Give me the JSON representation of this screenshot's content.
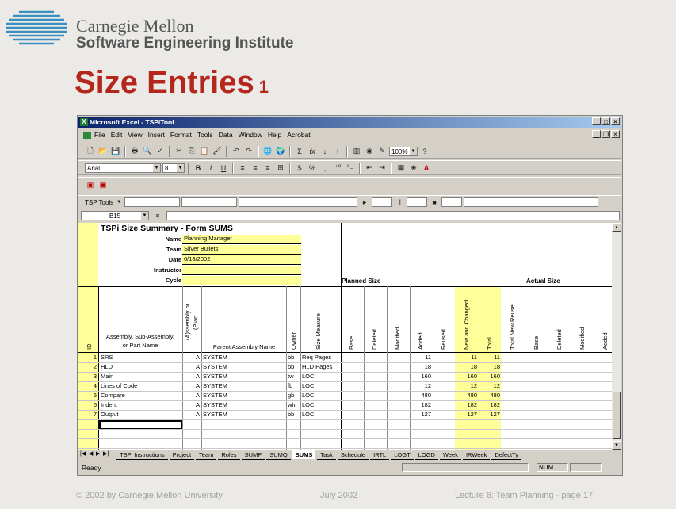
{
  "slide": {
    "org_line1": "Carnegie Mellon",
    "org_line2": "Software Engineering Institute",
    "title": "Size Entries",
    "title_num": "1",
    "footer_left": "© 2002 by Carnegie Mellon University",
    "footer_mid": "July 2002",
    "footer_right": "Lecture 6: Team Planning - page 17"
  },
  "app": {
    "title": "Microsoft Excel - TSPiTool",
    "menu": [
      "File",
      "Edit",
      "View",
      "Insert",
      "Format",
      "Tools",
      "Data",
      "Window",
      "Help",
      "Acrobat"
    ],
    "zoom": "100%",
    "font_name": "Arial",
    "font_size": "8",
    "tsp_tools": "TSP Tools",
    "name_box": "B15",
    "formula_eq": "=",
    "status": "Ready",
    "num_indicator": "NUM"
  },
  "form": {
    "title": "TSPi Size Summary - Form SUMS",
    "labels": {
      "name": "Name",
      "team": "Team",
      "date": "Date",
      "instructor": "Instructor",
      "cycle": "Cycle"
    },
    "values": {
      "name": "Planning Manager",
      "team": "Silver Bullets",
      "date": "6/18/2002",
      "instructor": "",
      "cycle": ""
    },
    "planned_size": "Planned Size",
    "actual_size": "Actual Size",
    "headers": {
      "id": "ID",
      "assembly": "Assembly, Sub-Assembly,",
      "assembly2": "or Part Name",
      "ap": "(A)ssembly or",
      "ap2": "(P)art",
      "parent": "Parent Assembly Name",
      "owner": "Owner",
      "size_measure": "Size Measure",
      "base": "Base",
      "deleted": "Deleted",
      "modified": "Modified",
      "added": "Added",
      "reused": "Reused",
      "new_changed": "New and Changed",
      "total": "Total",
      "total_new_reuse": "Total New Reuse",
      "a_base": "Base",
      "a_deleted": "Deleted",
      "a_modified": "Modified",
      "a_added": "Added"
    },
    "rows": [
      {
        "id": "1",
        "name": "SRS",
        "ap": "A",
        "parent": "SYSTEM",
        "owner": "bb",
        "measure": "Req Pages",
        "added": "11",
        "nc": "11",
        "total": "11"
      },
      {
        "id": "2",
        "name": "HLD",
        "ap": "A",
        "parent": "SYSTEM",
        "owner": "bb",
        "measure": "HLD Pages",
        "added": "18",
        "nc": "18",
        "total": "18"
      },
      {
        "id": "3",
        "name": "Main",
        "ap": "A",
        "parent": "SYSTEM",
        "owner": "tw",
        "measure": "LOC",
        "added": "160",
        "nc": "160",
        "total": "160"
      },
      {
        "id": "4",
        "name": "Lines of Code",
        "ap": "A",
        "parent": "SYSTEM",
        "owner": "fb",
        "measure": "LOC",
        "added": "12",
        "nc": "12",
        "total": "12"
      },
      {
        "id": "5",
        "name": "Compare",
        "ap": "A",
        "parent": "SYSTEM",
        "owner": "gb",
        "measure": "LOC",
        "added": "480",
        "nc": "480",
        "total": "480"
      },
      {
        "id": "6",
        "name": "Indent",
        "ap": "A",
        "parent": "SYSTEM",
        "owner": "wh",
        "measure": "LOC",
        "added": "182",
        "nc": "182",
        "total": "182"
      },
      {
        "id": "7",
        "name": "Output",
        "ap": "A",
        "parent": "SYSTEM",
        "owner": "bb",
        "measure": "LOC",
        "added": "127",
        "nc": "127",
        "total": "127"
      }
    ]
  },
  "tabs": [
    "TSPi Instructions",
    "Project",
    "Team",
    "Roles",
    "SUMP",
    "SUMQ",
    "SUMS",
    "Task",
    "Schedule",
    "IRTL",
    "LOGT",
    "LOGD",
    "Week",
    "IRWeek",
    "DefectTy"
  ],
  "active_tab": "SUMS",
  "colors": {
    "title_red": "#b5261c",
    "cell_yellow": "#ffff99",
    "excel_titlebar": "#0a246a"
  }
}
